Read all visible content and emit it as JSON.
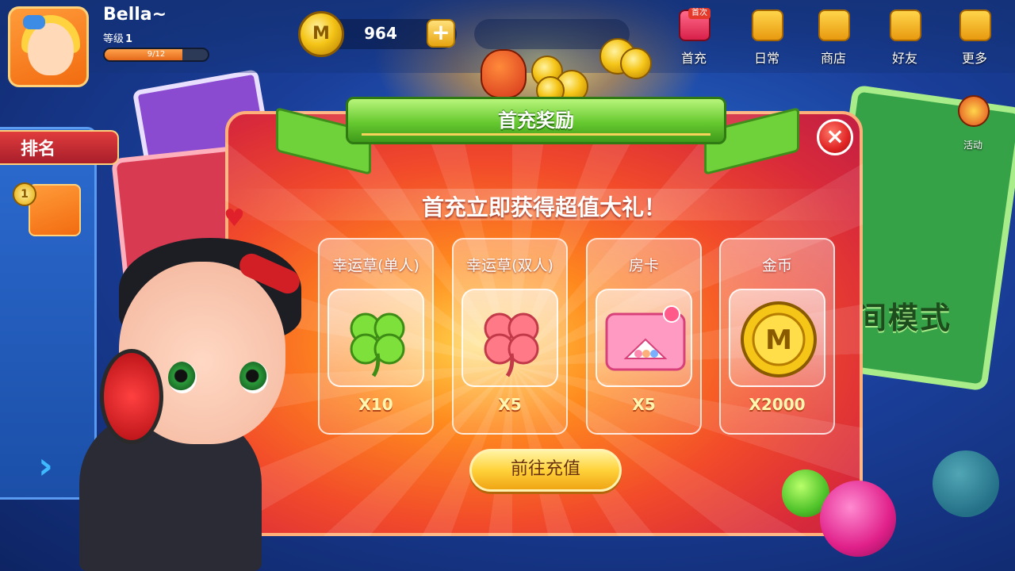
{
  "player": {
    "name": "Bella~",
    "level_label": "等级",
    "level": "1",
    "xp_text": "9/12",
    "xp_fraction": 0.75
  },
  "currency": {
    "coins": "964",
    "plus": "+"
  },
  "nav": [
    {
      "label": "首充",
      "badge": "首次",
      "icon": "gift-icon"
    },
    {
      "label": "日常",
      "icon": "calendar-icon"
    },
    {
      "label": "商店",
      "icon": "cart-icon"
    },
    {
      "label": "好友",
      "icon": "friends-icon"
    },
    {
      "label": "更多",
      "icon": "plus-icon"
    }
  ],
  "side": {
    "activity_label": "活动"
  },
  "ranking": {
    "title": "排名",
    "top_medal": "1",
    "arrow": "›"
  },
  "background": {
    "mode_text": "间模式"
  },
  "modal": {
    "title": "首充奖励",
    "subtitle": "首充立即获得超值大礼！",
    "close": "×",
    "cta": "前往充值",
    "rewards": [
      {
        "name": "幸运草(单人)",
        "qty": "X10",
        "icon": "green-clover-icon"
      },
      {
        "name": "幸运草(双人)",
        "qty": "X5",
        "icon": "pink-clover-icon"
      },
      {
        "name": "房卡",
        "qty": "X5",
        "icon": "room-card-icon"
      },
      {
        "name": "金币",
        "qty": "X2000",
        "icon": "gold-coin-icon"
      }
    ]
  },
  "colors": {
    "modal_red": "#e03a36",
    "ribbon_green": "#66c930",
    "button_gold": "#ffd23a",
    "quantity_yellow": "#fff7b0"
  }
}
